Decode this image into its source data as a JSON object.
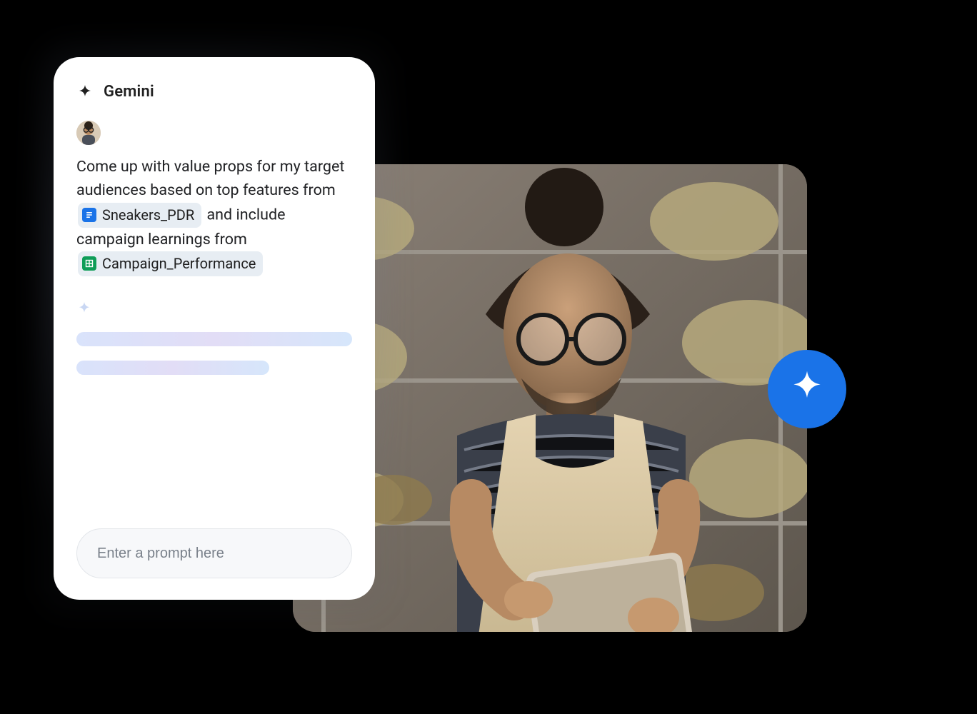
{
  "panel": {
    "title": "Gemini",
    "prompt": {
      "pre1": "Come up with value props for my target audiences based on top features from",
      "chip1": {
        "type": "docs",
        "label": "Sneakers_PDR"
      },
      "mid": "and include campaign learnings from",
      "chip2": {
        "type": "sheets",
        "label": "Campaign_Performance"
      }
    },
    "input": {
      "placeholder": "Enter a prompt here",
      "value": ""
    }
  },
  "colors": {
    "accent_blue": "#1a73e8",
    "sheets_green": "#0f9d58",
    "chip_bg": "#e7edf3"
  }
}
